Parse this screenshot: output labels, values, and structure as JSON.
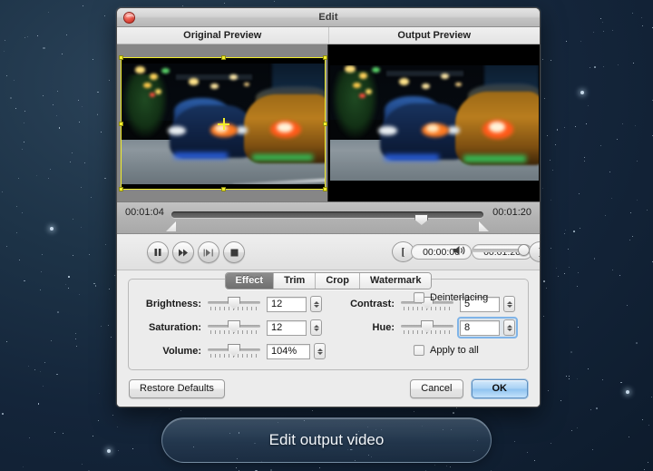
{
  "window": {
    "title": "Edit",
    "close_icon": "close-button-red"
  },
  "previews": {
    "original_label": "Original Preview",
    "output_label": "Output Preview",
    "crop_overlay_color": "#f2ee2a"
  },
  "timeline": {
    "current_time": "00:01:04",
    "total_time": "00:01:20",
    "playhead_percent": 80,
    "trim_in_percent": 12,
    "trim_out_percent": 92
  },
  "transport": {
    "buttons": [
      {
        "name": "pause-button",
        "icon": "pause-icon"
      },
      {
        "name": "fast-forward-button",
        "icon": "fast-forward-icon"
      },
      {
        "name": "step-frame-button",
        "icon": "step-frame-icon"
      },
      {
        "name": "stop-button",
        "icon": "stop-icon"
      }
    ],
    "mark_in_icon": "[",
    "mark_out_icon": "]",
    "start_time": "00:00:00",
    "end_time": "00:01:20",
    "volume_icon": "speaker-icon",
    "volume_percent": 100
  },
  "tabs": [
    {
      "label": "Effect",
      "active": true
    },
    {
      "label": "Trim",
      "active": false
    },
    {
      "label": "Crop",
      "active": false
    },
    {
      "label": "Watermark",
      "active": false
    }
  ],
  "effect": {
    "brightness": {
      "label": "Brightness:",
      "value": "12",
      "slider_percent": 50
    },
    "saturation": {
      "label": "Saturation:",
      "value": "12",
      "slider_percent": 50
    },
    "volume": {
      "label": "Volume:",
      "value": "104%",
      "slider_percent": 50
    },
    "contrast": {
      "label": "Contrast:",
      "value": "5",
      "slider_percent": 50
    },
    "hue": {
      "label": "Hue:",
      "value": "8",
      "slider_percent": 50,
      "focused": true
    },
    "deinterlacing": {
      "label": "Deinterlacing",
      "checked": false
    },
    "apply_to_all": {
      "label": "Apply to all",
      "checked": false
    }
  },
  "footer": {
    "restore_defaults": "Restore Defaults",
    "cancel": "Cancel",
    "ok": "OK",
    "ok_accent": "#8ec3f0"
  },
  "tooltip": {
    "text": "Edit output video"
  }
}
